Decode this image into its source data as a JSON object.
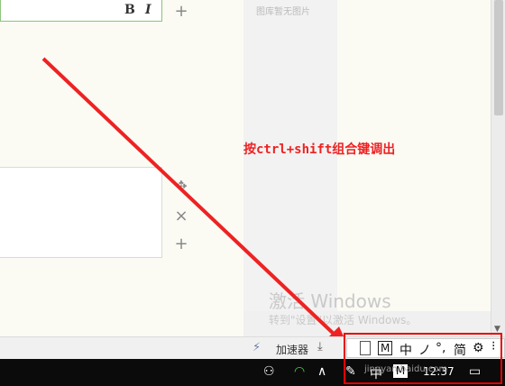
{
  "editor": {
    "bold_label": "B",
    "italic_label": "I",
    "add_symbol": "+",
    "move_symbol": "✥",
    "close_symbol": "×"
  },
  "image_panel": {
    "empty_text": "图库暂无图片"
  },
  "watermark": {
    "title": "激活 Windows",
    "subtitle": "转到\"设置\"以激活 Windows。"
  },
  "annotation": {
    "text": "按ctrl+shift组合键调出",
    "color": "#ee2222"
  },
  "statusbar": {
    "accelerator_label": "加速器"
  },
  "ime_bar": {
    "items": [
      "M",
      "中",
      "ノ",
      "°,",
      "简",
      "⚙"
    ]
  },
  "taskbar": {
    "ime_mode": "中",
    "clock": "12:37",
    "watermark_url": "jingyan.baidu.com"
  },
  "colors": {
    "highlight": "#e60000",
    "accent_green": "#8cc37c"
  }
}
